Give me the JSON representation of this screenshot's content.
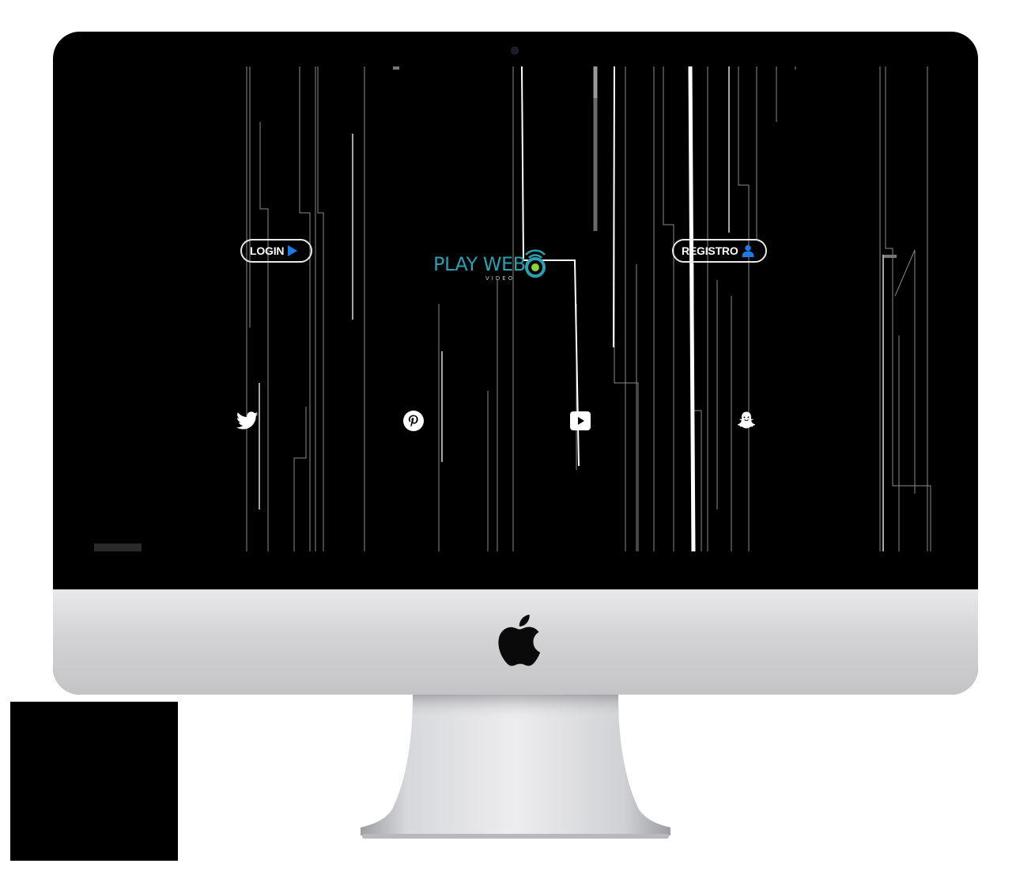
{
  "colors": {
    "accent_blue": "#1e7be6",
    "logo_teal": "#2c9eb0",
    "logo_green": "#8bd13a",
    "screen_bg": "#000000",
    "line_white": "#ffffff"
  },
  "header": {
    "login_label": "LOGIN",
    "login_icon": "play-triangle-icon",
    "registro_label": "REGISTRO",
    "registro_icon": "user-icon"
  },
  "logo": {
    "title": "PLAY WEB",
    "subtitle": "VIDEO",
    "mark_icon": "wifi-signal-icon"
  },
  "social": {
    "items": [
      {
        "name": "twitter",
        "icon": "twitter-icon"
      },
      {
        "name": "pinterest",
        "icon": "pinterest-icon"
      },
      {
        "name": "youtube",
        "icon": "youtube-icon"
      },
      {
        "name": "snapchat",
        "icon": "snapchat-icon"
      }
    ]
  },
  "device": {
    "brand_icon": "apple-logo-icon"
  }
}
